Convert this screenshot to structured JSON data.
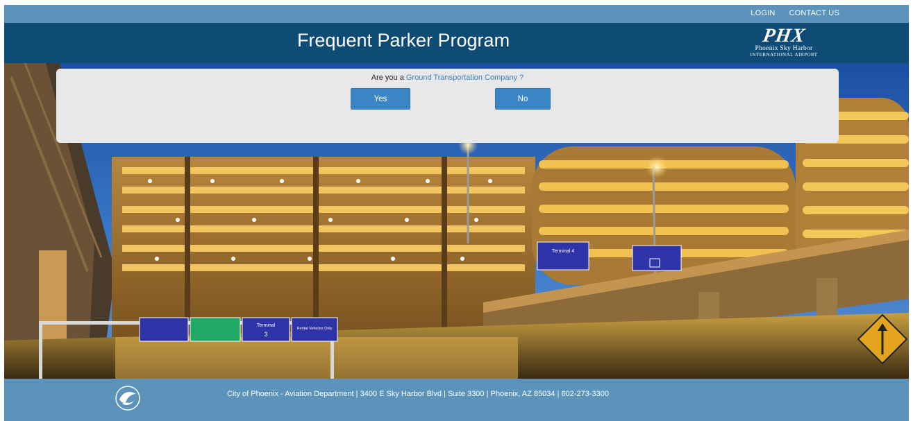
{
  "topbar": {
    "login_label": "LOGIN",
    "contact_label": "CONTACT US"
  },
  "header": {
    "title": "Frequent Parker Program",
    "logo_mark": "PHX",
    "logo_line1": "Phoenix Sky Harbor",
    "logo_line2": "INTERNATIONAL AIRPORT"
  },
  "hero": {
    "sign_terminal_4": "Terminal 4",
    "sign_terminal": "Terminal",
    "sign_terminal_3": "3",
    "sign_rental": "Rental Vehicles Only"
  },
  "dialog": {
    "question_prefix": "Are you a ",
    "question_link": "Ground Transportation Company ?",
    "yes_label": "Yes",
    "no_label": "No"
  },
  "footer": {
    "text": "City of Phoenix - Aviation Department | 3400 E Sky Harbor Blvd | Suite 3300 | Phoenix, AZ 85034 | 602-273-3300"
  },
  "colors": {
    "topbar": "#5b93ba",
    "header": "#0e4c75",
    "button": "#3b86c4",
    "link": "#3a7fbe",
    "dialog": "#e8e8e8"
  }
}
